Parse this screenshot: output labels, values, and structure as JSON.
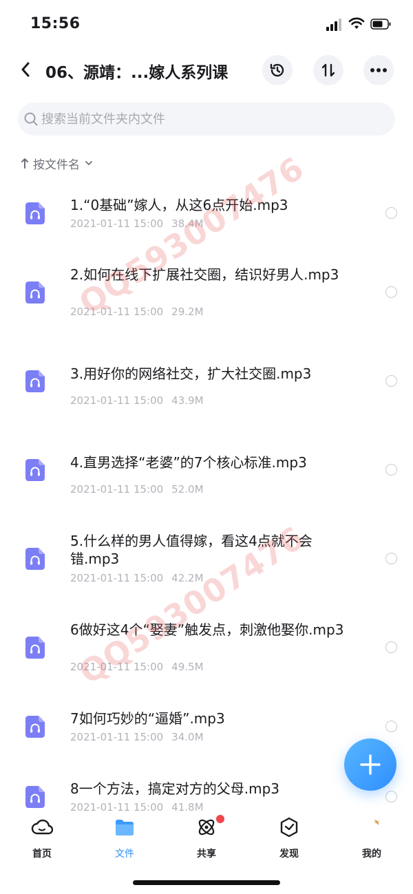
{
  "status_bar": {
    "time": "15:56"
  },
  "header": {
    "title": "06、源靖：...嫁人系列课"
  },
  "search": {
    "placeholder": "搜索当前文件夹内文件"
  },
  "sort": {
    "label": "按文件名"
  },
  "files": [
    {
      "name": "1.“0基础”嫁人，从这6点开始.mp3",
      "date": "2021-01-11 15:00",
      "size": "38.4M"
    },
    {
      "name": "2.如何在线下扩展社交圈，结识好男人.mp3",
      "date": "2021-01-11 15:00",
      "size": "29.2M"
    },
    {
      "name": "3.用好你的网络社交，扩大社交圈.mp3",
      "date": "2021-01-11 15:00",
      "size": "43.9M"
    },
    {
      "name": "4.直男选择“老婆”的7个核心标准.mp3",
      "date": "2021-01-11 15:00",
      "size": "52.0M"
    },
    {
      "name": "5.什么样的男人值得嫁，看这4点就不会错.mp3",
      "date": "2021-01-11 15:00",
      "size": "42.2M"
    },
    {
      "name": "6做好这4个“娶妻”触发点，刺激他娶你.mp3",
      "date": "2021-01-11 15:00",
      "size": "49.5M"
    },
    {
      "name": "7如何巧妙的“逼婚”.mp3",
      "date": "2021-01-11 15:00",
      "size": "34.0M"
    },
    {
      "name": "8一个方法，搞定对方的父母.mp3",
      "date": "2021-01-11 15:00",
      "size": "41.8M"
    }
  ],
  "watermark": {
    "text": "QQ593007476"
  },
  "tabs": [
    {
      "label": "首页",
      "icon": "cloud-icon"
    },
    {
      "label": "文件",
      "icon": "folder-icon",
      "active": true
    },
    {
      "label": "共享",
      "icon": "atom-icon",
      "badge": true
    },
    {
      "label": "发现",
      "icon": "compass-icon"
    },
    {
      "label": "我的",
      "icon": "avatar-icon"
    }
  ],
  "colors": {
    "accent": "#2f8fff",
    "file_icon": "#7b7ef5",
    "badge": "#f0474c"
  }
}
